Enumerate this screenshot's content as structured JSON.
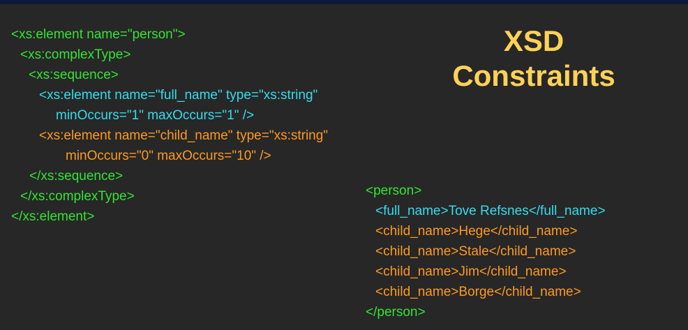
{
  "title": {
    "line1": "XSD",
    "line2": "Constraints"
  },
  "schema_code": [
    {
      "text": "<xs:element name=\"person\">",
      "color": "green"
    },
    {
      "text": "<xs:complexType>",
      "color": "green"
    },
    {
      "text": "<xs:sequence>",
      "color": "green"
    },
    {
      "text": "<xs:element name=\"full_name\" type=\"xs:string\"",
      "color": "cyan"
    },
    {
      "text": "minOccurs=\"1\" maxOccurs=\"1\" />",
      "color": "cyan"
    },
    {
      "text": "<xs:element name=\"child_name\" type=\"xs:string\"",
      "color": "orange"
    },
    {
      "text": "minOccurs=\"0\" maxOccurs=\"10\" />",
      "color": "orange"
    },
    {
      "text": "</xs:sequence>",
      "color": "green"
    },
    {
      "text": "</xs:complexType>",
      "color": "green"
    },
    {
      "text": "</xs:element>",
      "color": "green"
    }
  ],
  "xml_example": [
    {
      "text": "<person>",
      "color": "green"
    },
    {
      "text": "<full_name>Tove Refsnes</full_name>",
      "color": "cyan"
    },
    {
      "text": "<child_name>Hege</child_name>",
      "color": "orange"
    },
    {
      "text": "<child_name>Stale</child_name>",
      "color": "orange"
    },
    {
      "text": "<child_name>Jim</child_name>",
      "color": "orange"
    },
    {
      "text": "<child_name>Borge</child_name>",
      "color": "orange"
    },
    {
      "text": "</person>",
      "color": "green"
    }
  ],
  "colors": {
    "green": "#33e433",
    "cyan": "#33ddee",
    "orange": "#ff9a1f",
    "title": "#ffd257",
    "background": "#272727"
  }
}
